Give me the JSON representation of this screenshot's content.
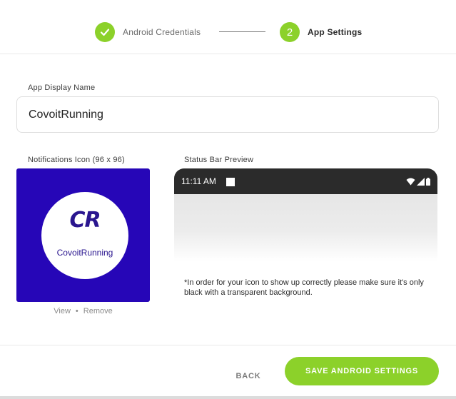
{
  "stepper": {
    "steps": [
      {
        "label": "Android Credentials",
        "state": "completed",
        "icon": "check-icon"
      },
      {
        "label": "App Settings",
        "number": "2",
        "state": "active"
      }
    ],
    "accent_color": "#8cd12a"
  },
  "app_display_name": {
    "label": "App Display Name",
    "value": "CovoitRunning"
  },
  "notifications_icon": {
    "label": "Notifications Icon (96 x 96)",
    "logo_text": "CR",
    "brand_text": "CovoitRunning",
    "background_color": "#2606b7",
    "view_label": "View",
    "separator": "•",
    "remove_label": "Remove"
  },
  "status_bar_preview": {
    "label": "Status Bar Preview",
    "time": "11:11 AM",
    "icons": [
      "notification-square-icon",
      "wifi-icon",
      "signal-icon",
      "battery-icon"
    ],
    "note": "*In order for your icon to show up correctly please make sure it's only black with a transparent background."
  },
  "footer": {
    "back_label": "BACK",
    "save_label": "SAVE ANDROID SETTINGS"
  }
}
